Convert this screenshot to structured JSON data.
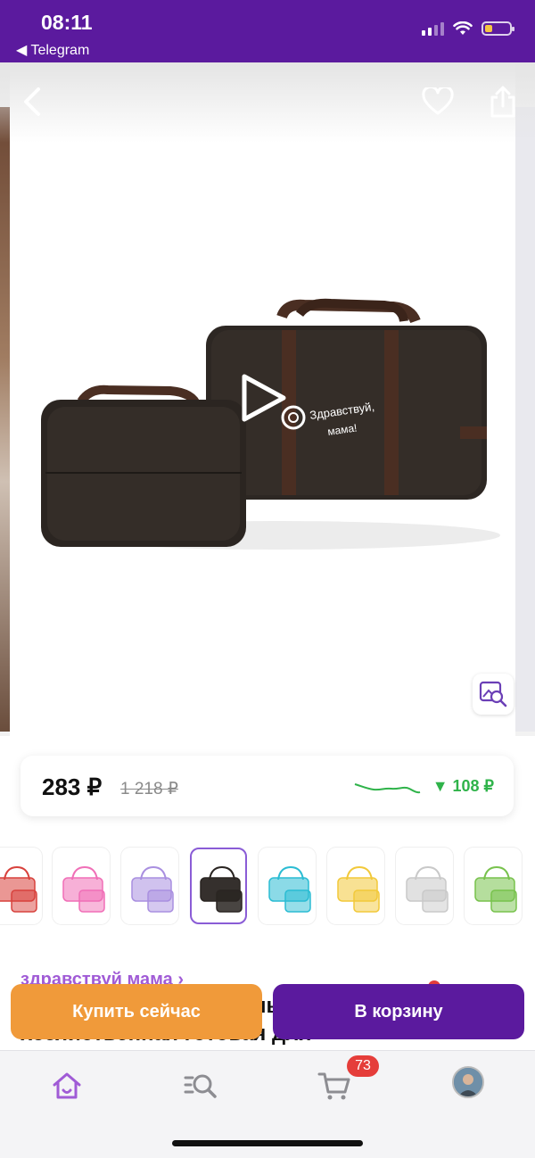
{
  "status_bar": {
    "time": "08:11",
    "back_app": "◀ Telegram"
  },
  "gallery": {
    "brand_text_line1": "Здравствуй,",
    "brand_text_line2": "мама!"
  },
  "price": {
    "current": "283 ₽",
    "old": "1 218 ₽",
    "drop": "▼ 108 ₽",
    "drop_color": "#2fb34a"
  },
  "swatches": [
    {
      "color": "#d8423d",
      "selected": false
    },
    {
      "color": "#f06fb7",
      "selected": false
    },
    {
      "color": "#a98fe0",
      "selected": false
    },
    {
      "color": "#2a2522",
      "selected": true
    },
    {
      "color": "#2bbcd3",
      "selected": false
    },
    {
      "color": "#f2c93a",
      "selected": false
    },
    {
      "color": "#c9c9c9",
      "selected": false
    },
    {
      "color": "#78c24d",
      "selected": false
    }
  ],
  "product": {
    "brand_link": "здравствуй мама ›",
    "title_partial_1": "хозяйственная готовая для",
    "title_partial_2": "ны"
  },
  "actions": {
    "buy_now": "Купить сейчас",
    "add_to_cart": "В корзину"
  },
  "tabbar": {
    "cart_count": "73",
    "active_color": "#a05bd6"
  },
  "colors": {
    "brand_purple": "#5b1a9e",
    "buy_orange": "#f09a3a"
  }
}
